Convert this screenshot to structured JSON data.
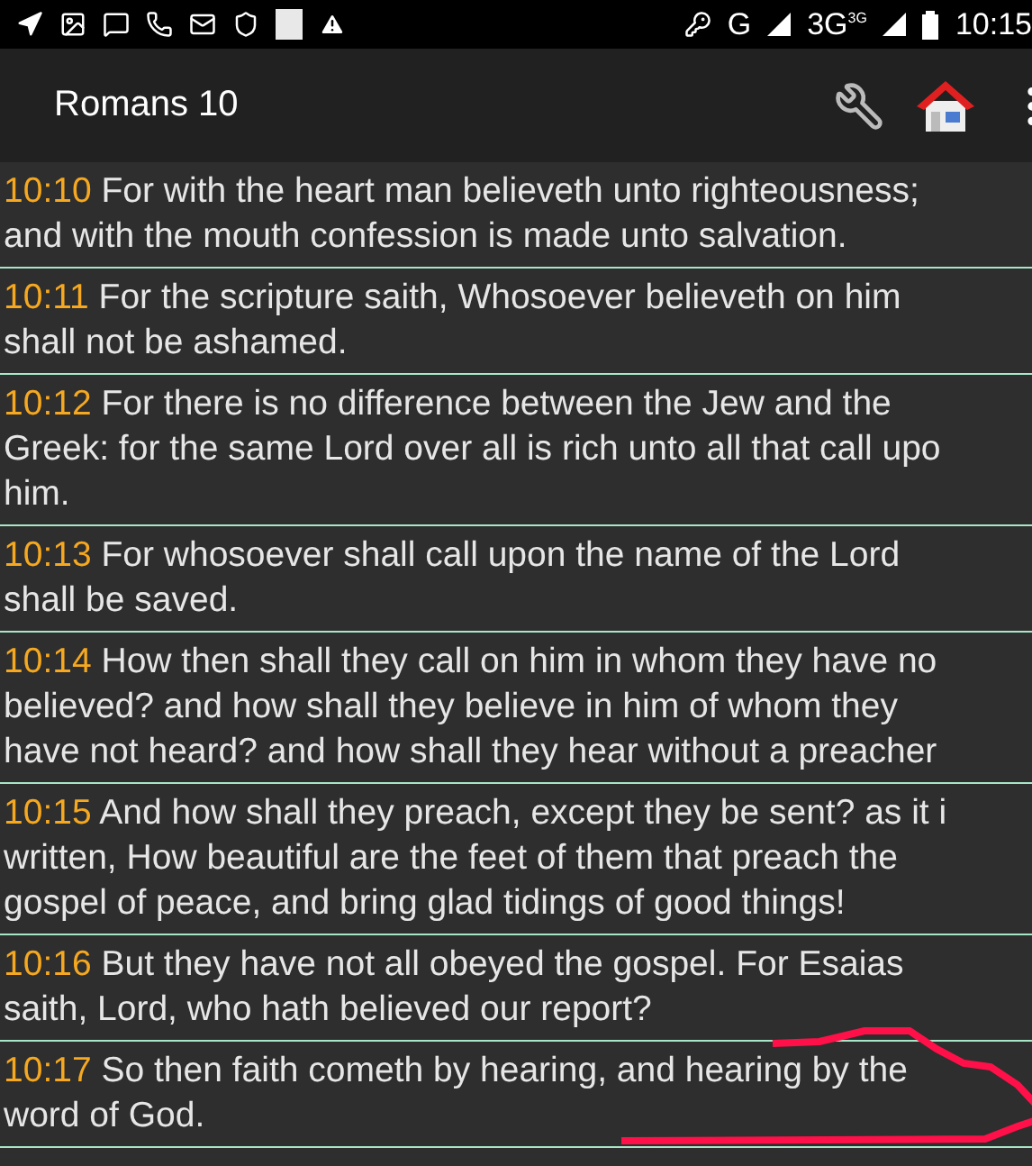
{
  "status_bar": {
    "network": "G",
    "network_2": "3G",
    "network_2_badge": "3G",
    "time": "10:15"
  },
  "app_bar": {
    "title": "Romans 10"
  },
  "verses": [
    {
      "number": "10:10",
      "lines": [
        "For with the heart man believeth unto righteousness;",
        "and with the mouth confession is made unto salvation."
      ]
    },
    {
      "number": "10:11",
      "lines": [
        "For the scripture saith, Whosoever believeth on him",
        "shall not be ashamed."
      ]
    },
    {
      "number": "10:12",
      "lines": [
        "For there is no difference between the Jew and the",
        "Greek: for the same Lord over all is rich unto all that call upo",
        "him."
      ]
    },
    {
      "number": "10:13",
      "lines": [
        "For whosoever shall call upon the name of the Lord",
        "shall be saved."
      ]
    },
    {
      "number": "10:14",
      "lines": [
        "How then shall they call on him in whom they have no",
        "believed? and how shall they believe in him of whom they",
        "have not heard? and how shall they hear without a preacher"
      ]
    },
    {
      "number": "10:15",
      "lines": [
        "And how shall they preach, except they be sent? as it i",
        "written, How beautiful are the feet of them that preach the",
        "gospel of peace, and bring glad tidings of good things!"
      ]
    },
    {
      "number": "10:16",
      "lines": [
        "But they have not all obeyed the gospel. For Esaias",
        "saith, Lord, who hath believed our report?"
      ]
    },
    {
      "number": "10:17",
      "lines": [
        "So then faith cometh by hearing, and hearing by the",
        "word of God."
      ]
    }
  ]
}
